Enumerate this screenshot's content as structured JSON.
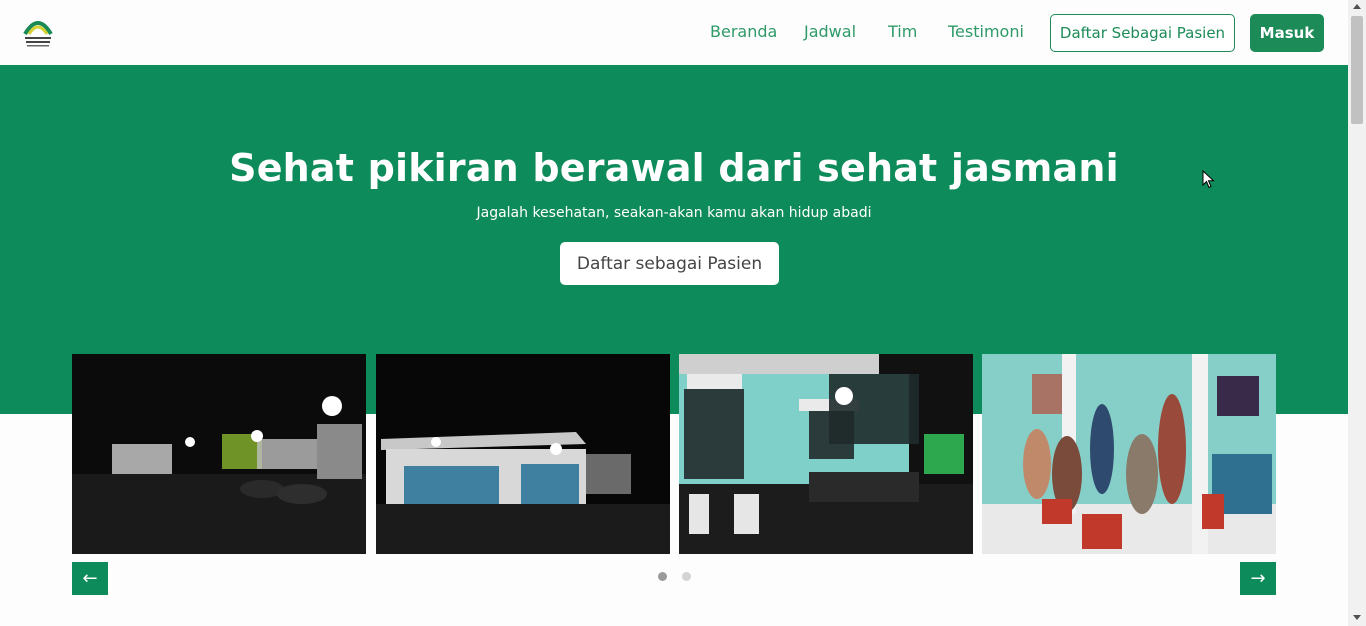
{
  "navbar": {
    "links": [
      "Beranda",
      "Jadwal",
      "Tim",
      "Testimoni"
    ],
    "register_button": "Daftar Sebagai Pasien",
    "login_button": "Masuk",
    "brand_color": "#1c8b57"
  },
  "hero": {
    "title": "Sehat pikiran berawal dari sehat jasmani",
    "subtitle": "Jagalah kesehatan, seakan-akan kamu akan hidup abadi",
    "cta_label": "Daftar sebagai Pasien",
    "background": "#0e8b5a"
  },
  "carousel": {
    "prev_icon": "arrow-left-icon",
    "next_icon": "arrow-right-icon",
    "dots": 2,
    "active_dot": 1
  }
}
